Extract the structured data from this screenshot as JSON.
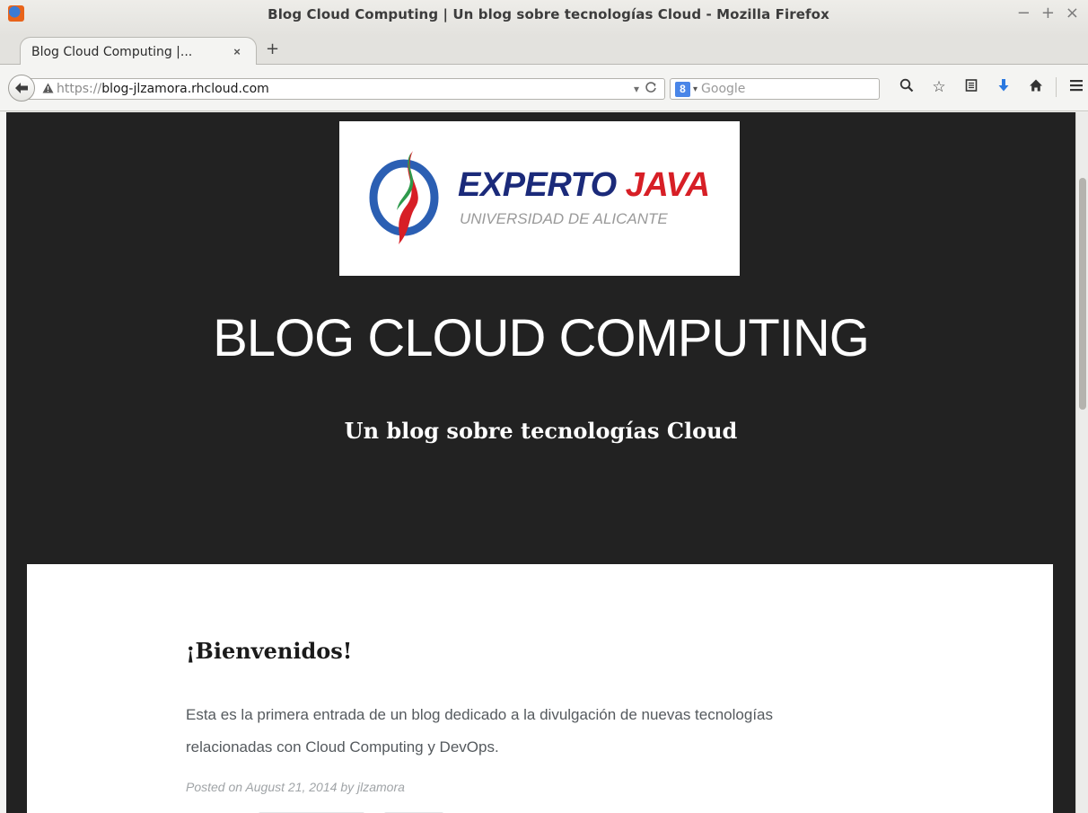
{
  "window": {
    "title": "Blog Cloud Computing | Un blog sobre tecnologías Cloud - Mozilla Firefox",
    "controls": {
      "minimize": "−",
      "maximize": "+",
      "close": "×"
    }
  },
  "tabs": [
    {
      "label": "Blog Cloud Computing |...",
      "close": "×",
      "active": true
    }
  ],
  "new_tab_label": "+",
  "navbar": {
    "back": "🡐",
    "url_protocol": "https://",
    "url_host": "blog-jlzamora.rhcloud.com",
    "url_dropdown": "▾",
    "reload": "C",
    "search_engine_letter": "8",
    "search_engine_dropdown": "▾",
    "search_placeholder": "Google",
    "search_icon": "search-icon",
    "toolbar_icons": [
      "star-icon",
      "reading-list-icon",
      "download-icon",
      "home-icon",
      "menu-icon"
    ]
  },
  "page": {
    "logo": {
      "title_part1": "EXPERTO",
      "title_part2": "JAVA",
      "subtitle": "UNIVERSIDAD DE ALICANTE"
    },
    "site_title": "BLOG CLOUD COMPUTING",
    "site_tagline": "Un blog sobre tecnologías Cloud",
    "post": {
      "title": "¡Bienvenidos!",
      "body_line1": "Esta es la primera entrada de un blog dedicado a la divulgación de nuevas tecnologías",
      "body_line2": "relacionadas con Cloud Computing y DevOps.",
      "meta_prefix": "Posted on",
      "date": "August 21, 2014",
      "meta_by": "by",
      "author": "jlzamora"
    }
  },
  "colors": {
    "page_background": "#222222",
    "logo_blue": "#1b2a7a",
    "logo_red": "#d71f26",
    "download_icon": "#2a78e0"
  }
}
